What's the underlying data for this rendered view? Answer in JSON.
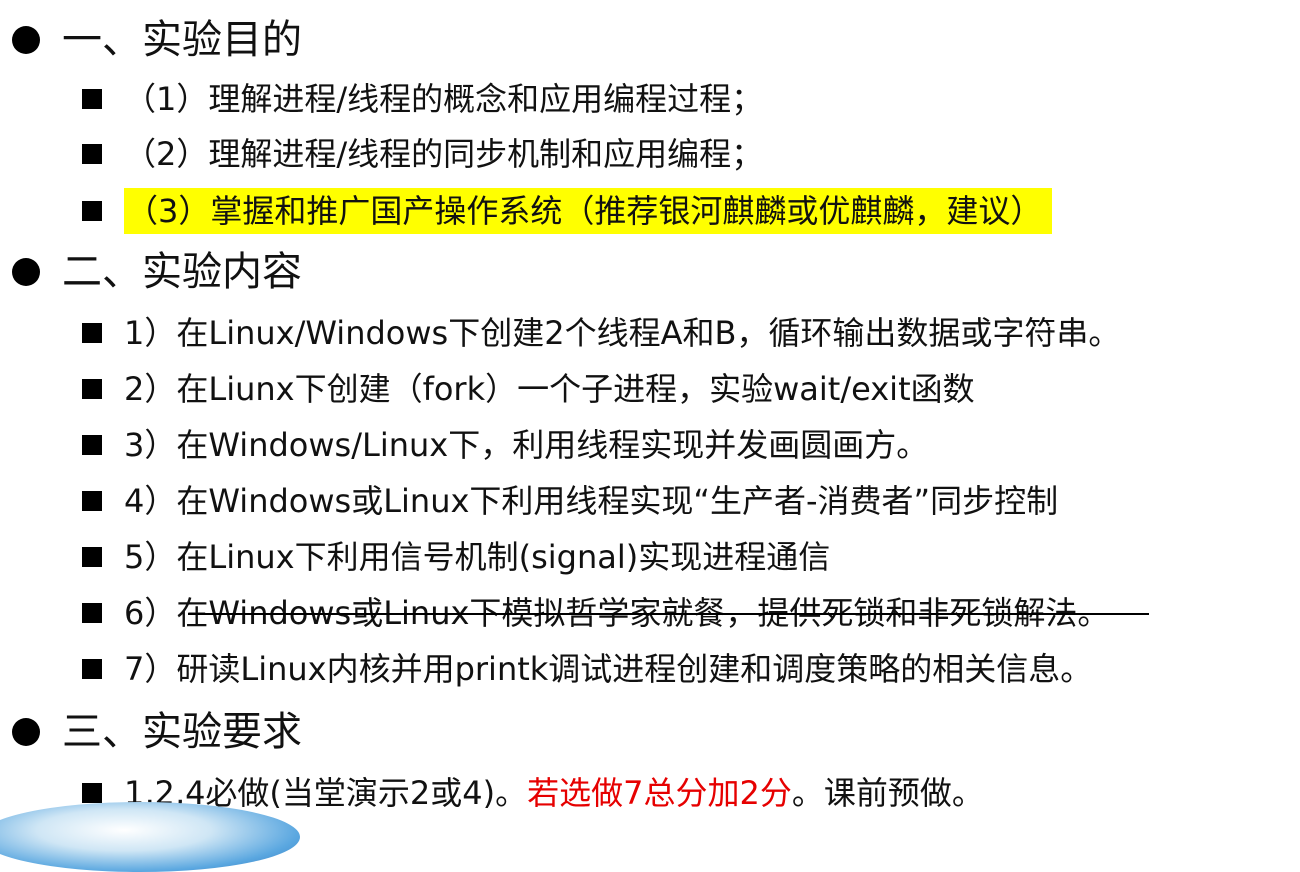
{
  "sections": [
    {
      "title": "一、实验目的",
      "items": [
        "（1）理解进程/线程的概念和应用编程过程；",
        "（2）理解进程/线程的同步机制和应用编程；",
        "（3）掌握和推广国产操作系统（推荐银河麒麟或优麒麟，建议）"
      ]
    },
    {
      "title": "二、实验内容",
      "items": [
        "1）在Linux/Windows下创建2个线程A和B，循环输出数据或字符串。",
        "2）在Liunx下创建（fork）一个子进程，实验wait/exit函数",
        "3）在Windows/Linux下，利用线程实现并发画圆画方。",
        "4）在Windows或Linux下利用线程实现“生产者-消费者”同步控制",
        "5）在Linux下利用信号机制(signal)实现进程通信",
        "6）在Windows或Linux下模拟哲学家就餐，提供死锁和非死锁解法。",
        "7）研读Linux内核并用printk调试进程创建和调度策略的相关信息。"
      ]
    },
    {
      "title": "三、实验要求",
      "requirement": {
        "part1": "1,2,4必做(当堂演示2或4)。",
        "part2_red": "若选做7总分加2分",
        "part3": "。课前预做。"
      }
    }
  ],
  "colors": {
    "highlight": "#ffff00",
    "emphasis_red": "#e60000"
  }
}
